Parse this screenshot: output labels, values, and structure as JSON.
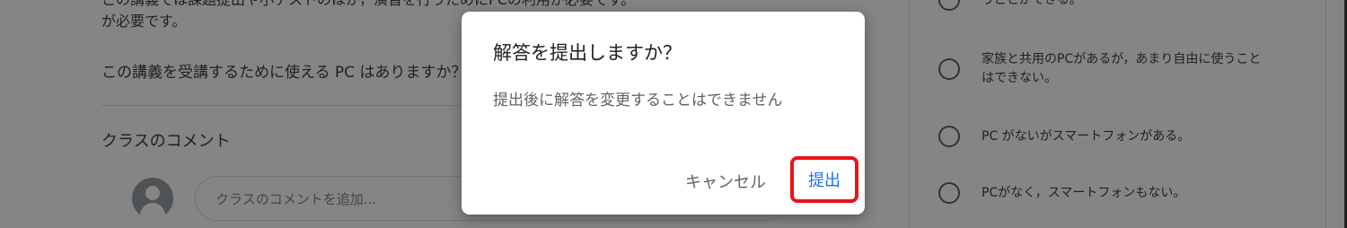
{
  "question_area": {
    "description_cut": "この講義では課題提出や小テストのほか，演習を行うためにPCの利用が必要です。",
    "description_line2": "が必要です。",
    "question_text": "この講義を受講するために使える PC はありますか？",
    "comments_title": "クラスのコメント",
    "comment_placeholder": "クラスのコメントを追加..."
  },
  "choices": [
    {
      "label": "うことができる。"
    },
    {
      "label": "家族と共用のPCがあるが，あまり自由に使うことはできない。"
    },
    {
      "label": "PC がないがスマートフォンがある。"
    },
    {
      "label": "PCがなく，スマートフォンもない。"
    }
  ],
  "dialog": {
    "title": "解答を提出しますか？",
    "body": "提出後に解答を変更することはできません",
    "cancel_label": "キャンセル",
    "submit_label": "提出"
  },
  "colors": {
    "accent": "#1a73e8",
    "highlight_box": "#e8141b",
    "overlay": "rgba(0,0,0,0.48)"
  }
}
